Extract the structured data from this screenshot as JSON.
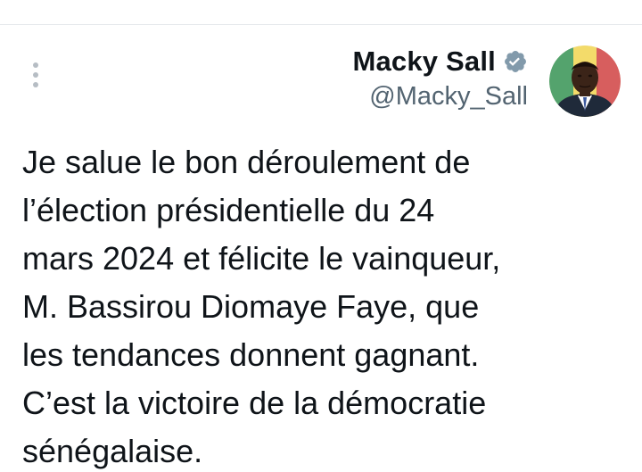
{
  "tweet": {
    "author": {
      "display_name": "Macky Sall",
      "handle": "@Macky_Sall",
      "verified_icon": "verified-badge-icon",
      "avatar_icon": "avatar"
    },
    "menu_icon": "more-options-icon",
    "text_lines": [
      "Je salue le bon déroulement de",
      "l’élection présidentielle du 24",
      "mars 2024 et félicite le vainqueur,",
      "M. Bassirou Diomaye Faye, que",
      "les tendances donnent gagnant.",
      "C’est la victoire de la démocratie",
      "sénégalaise."
    ]
  },
  "colors": {
    "text": "#0f1419",
    "secondary_text": "#536471",
    "verified_badge": "#829aab",
    "divider": "#e6e9ec",
    "menu_dots": "#b6bdc4"
  }
}
